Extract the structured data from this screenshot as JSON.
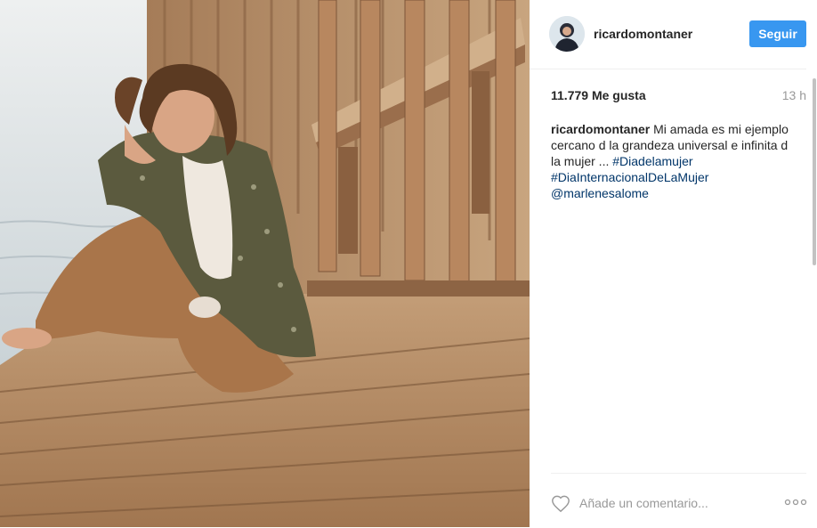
{
  "post": {
    "image_alt": "Foto de la publicación"
  },
  "header": {
    "username": "ricardomontaner",
    "follow_label": "Seguir",
    "avatar_icon": "profile-avatar"
  },
  "stats": {
    "likes": "11.779 Me gusta",
    "time": "13 h"
  },
  "caption": {
    "username": "ricardomontaner",
    "text": "Mi amada es mi ejemplo cercano d la grandeza universal e infinita d la mujer ...",
    "hashtag1": "#Diadelamujer",
    "hashtag2": "#DiaInternacionalDeLaMujer",
    "mention": "@marlenesalome"
  },
  "comment": {
    "placeholder": "Añade un comentario...",
    "like_icon": "heart-icon",
    "more_icon": "more-options-icon"
  },
  "colors": {
    "accent": "#3897f0",
    "link": "#003569",
    "muted": "#999999"
  }
}
